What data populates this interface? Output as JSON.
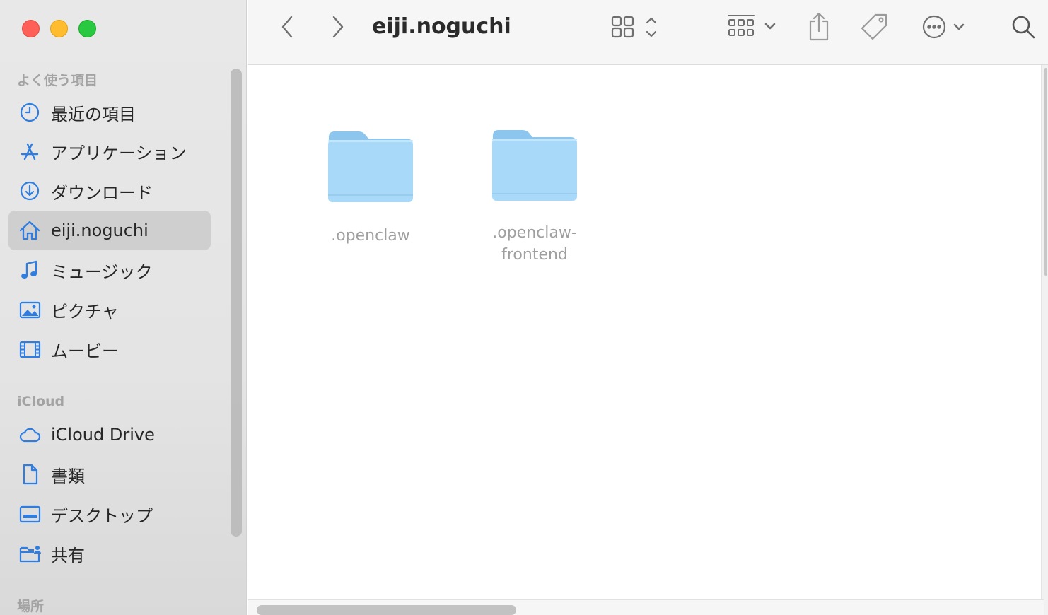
{
  "window": {
    "title": "eiji.noguchi"
  },
  "sidebar": {
    "sections": [
      {
        "header": "よく使う項目",
        "items": [
          {
            "label": "最近の項目",
            "icon": "clock-icon"
          },
          {
            "label": "アプリケーション",
            "icon": "applications-icon"
          },
          {
            "label": "ダウンロード",
            "icon": "download-icon"
          },
          {
            "label": "eiji.noguchi",
            "icon": "home-icon",
            "selected": true
          },
          {
            "label": "ミュージック",
            "icon": "music-icon"
          },
          {
            "label": "ピクチャ",
            "icon": "photo-icon"
          },
          {
            "label": "ムービー",
            "icon": "film-icon"
          }
        ]
      },
      {
        "header": "iCloud",
        "items": [
          {
            "label": "iCloud Drive",
            "icon": "cloud-icon"
          },
          {
            "label": "書類",
            "icon": "document-icon"
          },
          {
            "label": "デスクトップ",
            "icon": "desktop-icon"
          },
          {
            "label": "共有",
            "icon": "shared-folder-icon"
          }
        ]
      },
      {
        "header": "場所",
        "items": []
      }
    ]
  },
  "toolbar": {
    "buttons": [
      "back-icon",
      "forward-icon",
      "icon-view-icon",
      "group-icon",
      "share-icon",
      "tag-icon",
      "more-icon",
      "search-icon"
    ]
  },
  "files": [
    {
      "name": ".openclaw",
      "kind": "folder",
      "hidden": true
    },
    {
      "name": ".openclaw-frontend",
      "kind": "folder",
      "hidden": true
    }
  ],
  "colors": {
    "accent": "#2f7de1",
    "folder_body": "#a9d9f8",
    "folder_tab": "#8cc6ee",
    "selected_row": "#cfcfcf"
  }
}
